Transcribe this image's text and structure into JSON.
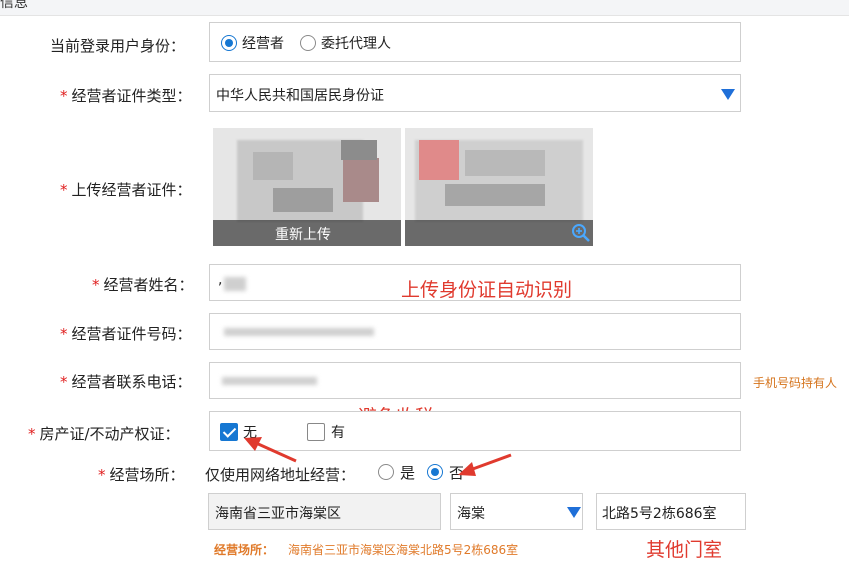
{
  "header": {
    "title": "信息"
  },
  "form": {
    "identity": {
      "label": "当前登录用户身份：",
      "options": [
        {
          "label": "经营者",
          "selected": true
        },
        {
          "label": "委托代理人",
          "selected": false
        }
      ]
    },
    "id_type": {
      "label": "经营者证件类型：",
      "value": "中华人民共和国居民身份证"
    },
    "id_upload": {
      "label": "上传经营者证件：",
      "reupload_label": "重新上传",
      "zoom_icon": "zoom-in-icon"
    },
    "name": {
      "label": "经营者姓名：",
      "value": ","
    },
    "id_number": {
      "label": "经营者证件号码：",
      "value": ""
    },
    "phone": {
      "label": "经营者联系电话：",
      "value": "",
      "hint": "手机号码持有人"
    },
    "property": {
      "label": "房产证/不动产权证：",
      "options": [
        {
          "label": "无",
          "checked": true
        },
        {
          "label": "有",
          "checked": false
        }
      ]
    },
    "location": {
      "label": "经营场所：",
      "online_only_label": "仅使用网络地址经营：",
      "options": [
        {
          "label": "是",
          "selected": false
        },
        {
          "label": "否",
          "selected": true
        }
      ],
      "region": "海南省三亚市海棠区",
      "street_select": "海棠",
      "room": "北路5号2栋686室",
      "summary_label": "经营场所：",
      "summary_value": "海南省三亚市海棠区海棠北路5号2栋686室"
    }
  },
  "annotations": {
    "auto_recognize": "上传身份证自动识别",
    "avoid_tax": "避免收税",
    "other_room": "其他门室"
  },
  "colors": {
    "accent": "#1677d2",
    "annotation": "#e03a2e",
    "required": "#e02020",
    "hint": "#d5731b"
  }
}
